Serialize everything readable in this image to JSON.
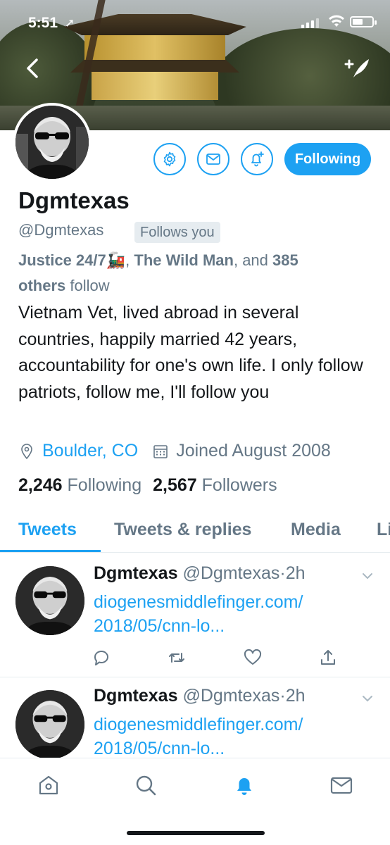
{
  "status_bar": {
    "time": "5:51"
  },
  "profile": {
    "name": "Dgmtexas",
    "handle": "@Dgmtexas",
    "follows_you": "Follows you",
    "followed_by": {
      "name1": "Justice 24/7",
      "emoji1": "🚂",
      "sep1": ", ",
      "name2": "The Wild Man",
      "and": ", and ",
      "others_count": "385",
      "others_label": "others",
      "follow": " follow"
    },
    "bio": "Vietnam Vet, lived abroad in several countries, happily married 42 years, accountability for one's own life. I only follow patriots, follow me, I'll follow you",
    "location": "Boulder, CO",
    "joined": "Joined August 2008",
    "following_count": "2,246",
    "following_label": "Following",
    "followers_count": "2,567",
    "followers_label": "Followers",
    "following_button": "Following"
  },
  "tabs": [
    {
      "label": "Tweets",
      "active": true
    },
    {
      "label": "Tweets & replies",
      "active": false
    },
    {
      "label": "Media",
      "active": false
    },
    {
      "label": "Li",
      "active": false
    }
  ],
  "tweets": [
    {
      "name": "Dgmtexas",
      "handle": "@Dgmtexas",
      "dot": "·",
      "time": "2h",
      "text": "diogenesmiddlefinger.com/ 2018/05/cnn-lo..."
    },
    {
      "name": "Dgmtexas",
      "handle": "@Dgmtexas",
      "dot": "·",
      "time": "2h",
      "text": "diogenesmiddlefinger.com/ 2018/05/cnn-lo..."
    }
  ],
  "colors": {
    "accent": "#1da1f2",
    "secondary_text": "#657786",
    "primary_text": "#14171a"
  },
  "icons": {
    "action_buttons": [
      "gear-icon",
      "mail-icon",
      "bell-plus-icon"
    ],
    "tweet_actions": [
      "reply-icon",
      "retweet-icon",
      "like-icon",
      "share-icon"
    ],
    "nav": [
      "home-icon",
      "search-icon",
      "notifications-icon",
      "messages-icon"
    ]
  }
}
